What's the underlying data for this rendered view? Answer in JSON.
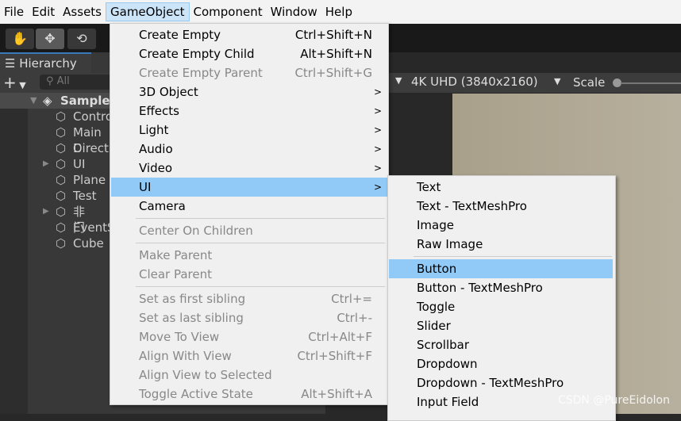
{
  "menubar": [
    "File",
    "Edit",
    "Assets",
    "GameObject",
    "Component",
    "Window",
    "Help"
  ],
  "toolbar": {
    "icons": [
      "hand-icon",
      "move-icon",
      "rotate-icon"
    ]
  },
  "hierarchy": {
    "tab": "Hierarchy",
    "add": "+",
    "search_placeholder": "All",
    "scene": "SampleS",
    "items": [
      {
        "label": "Contro",
        "arrow": false
      },
      {
        "label": "Main C",
        "arrow": false
      },
      {
        "label": "Directi",
        "arrow": false
      },
      {
        "label": "UI",
        "arrow": true
      },
      {
        "label": "Plane",
        "arrow": false
      },
      {
        "label": "Test",
        "arrow": false
      },
      {
        "label": "非门",
        "arrow": true
      },
      {
        "label": "EventS",
        "arrow": false
      },
      {
        "label": "Cube",
        "arrow": false
      }
    ]
  },
  "game": {
    "resolution": "4K UHD (3840x2160)",
    "scale": "Scale"
  },
  "menu": [
    {
      "label": "Create Empty",
      "shortcut": "Ctrl+Shift+N"
    },
    {
      "label": "Create Empty Child",
      "shortcut": "Alt+Shift+N"
    },
    {
      "label": "Create Empty Parent",
      "shortcut": "Ctrl+Shift+G",
      "disabled": true
    },
    {
      "label": "3D Object",
      "sub": true
    },
    {
      "label": "Effects",
      "sub": true
    },
    {
      "label": "Light",
      "sub": true
    },
    {
      "label": "Audio",
      "sub": true
    },
    {
      "label": "Video",
      "sub": true
    },
    {
      "label": "UI",
      "sub": true,
      "highlight": true
    },
    {
      "label": "Camera"
    },
    {
      "sep": true
    },
    {
      "label": "Center On Children",
      "disabled": true
    },
    {
      "sep": true
    },
    {
      "label": "Make Parent",
      "disabled": true
    },
    {
      "label": "Clear Parent",
      "disabled": true
    },
    {
      "sep": true
    },
    {
      "label": "Set as first sibling",
      "shortcut": "Ctrl+=",
      "disabled": true
    },
    {
      "label": "Set as last sibling",
      "shortcut": "Ctrl+-",
      "disabled": true
    },
    {
      "label": "Move To View",
      "shortcut": "Ctrl+Alt+F",
      "disabled": true
    },
    {
      "label": "Align With View",
      "shortcut": "Ctrl+Shift+F",
      "disabled": true
    },
    {
      "label": "Align View to Selected",
      "disabled": true
    },
    {
      "label": "Toggle Active State",
      "shortcut": "Alt+Shift+A",
      "disabled": true
    }
  ],
  "submenu": [
    {
      "label": "Text"
    },
    {
      "label": "Text - TextMeshPro"
    },
    {
      "label": "Image"
    },
    {
      "label": "Raw Image"
    },
    {
      "sep": true
    },
    {
      "label": "Button",
      "highlight": true
    },
    {
      "label": "Button - TextMeshPro"
    },
    {
      "label": "Toggle"
    },
    {
      "label": "Slider"
    },
    {
      "label": "Scrollbar"
    },
    {
      "label": "Dropdown"
    },
    {
      "label": "Dropdown - TextMeshPro"
    },
    {
      "label": "Input Field"
    }
  ],
  "watermark": "CSDN @PureEidolon"
}
